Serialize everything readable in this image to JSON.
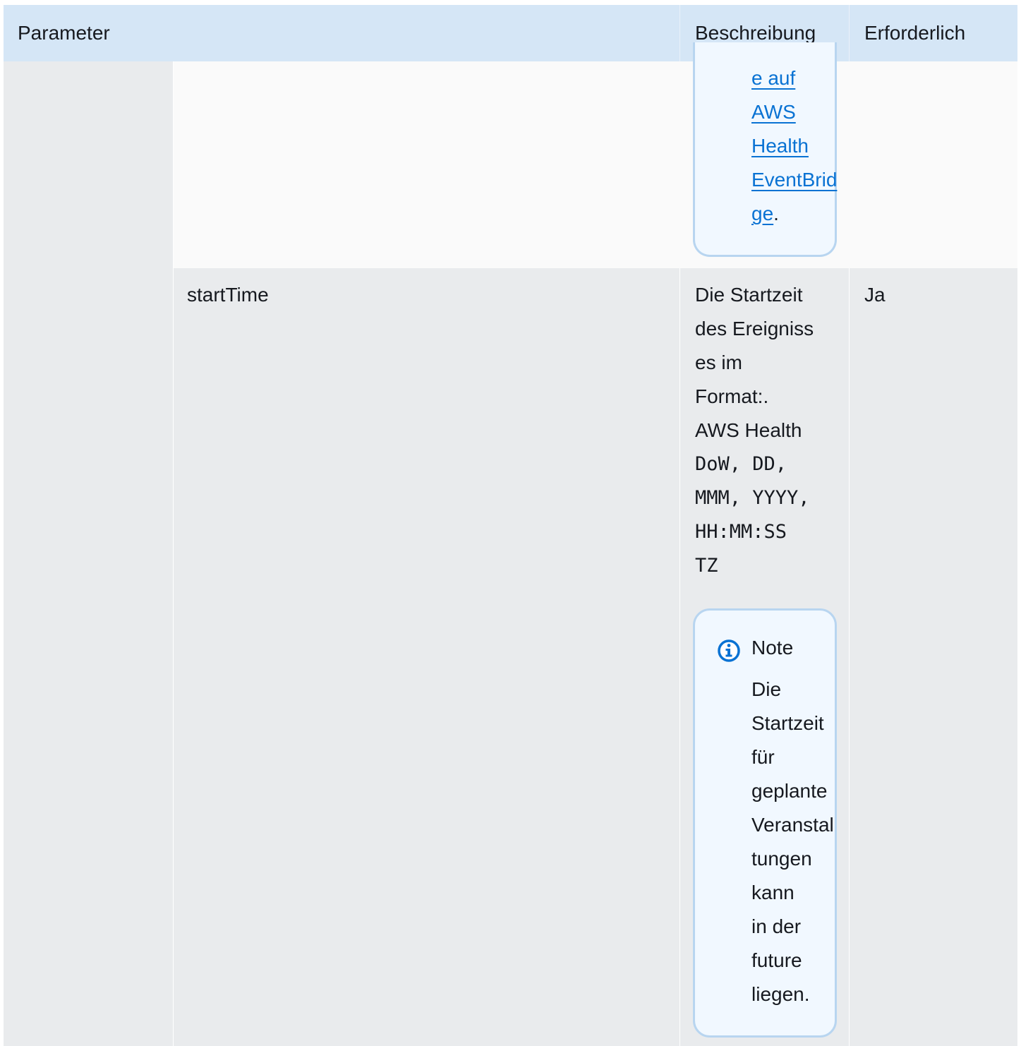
{
  "table": {
    "headers": {
      "parameter": "Parameter",
      "description": "Beschreibung",
      "required": "Erforderlich"
    },
    "row_top": {
      "note_link_lines": [
        "e auf",
        "AWS",
        "Health",
        "EventBrid",
        "ge"
      ],
      "note_trailing": "."
    },
    "row_start": {
      "parameter": "startTime",
      "description_lines": [
        "Die Startzeit",
        "des Ereigniss",
        "es im",
        "Format:.",
        "AWS Health"
      ],
      "format_lines": [
        "DoW, DD,",
        "MMM, YYYY,",
        "HH:MM:SS",
        "TZ"
      ],
      "required": "Ja",
      "note": {
        "icon": "info-icon",
        "title": "Note",
        "lines": [
          "Die",
          "Startzeit",
          "für",
          "geplante",
          "Veranstal",
          "tungen",
          "kann",
          "in der",
          "future",
          "liegen."
        ]
      }
    }
  },
  "colors": {
    "header_bg": "#d5e6f6",
    "row_bg": "#e9ebed",
    "note_bg": "#f1f8ff",
    "note_border": "#b8d5f0",
    "link": "#0972d3"
  }
}
